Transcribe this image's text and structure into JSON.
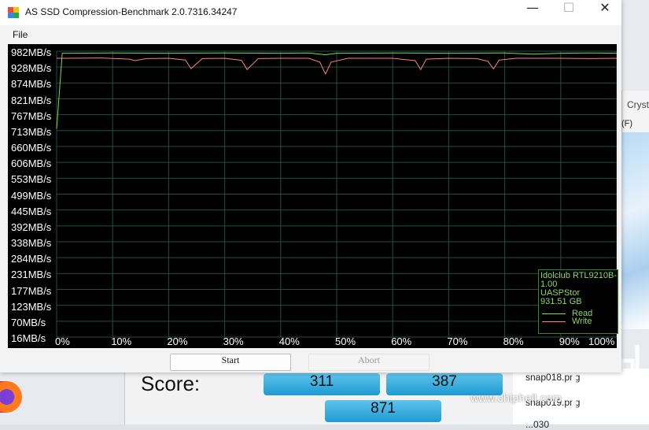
{
  "window": {
    "title": "AS SSD Compression-Benchmark 2.0.7316.34247",
    "minimize_glyph": "—",
    "maximize_glyph": "☐",
    "close_glyph": "✕"
  },
  "menu": {
    "file_label": "File"
  },
  "chart_data": {
    "type": "line",
    "y_tick_labels": [
      "982MB/s",
      "928MB/s",
      "874MB/s",
      "821MB/s",
      "767MB/s",
      "713MB/s",
      "660MB/s",
      "606MB/s",
      "553MB/s",
      "499MB/s",
      "445MB/s",
      "392MB/s",
      "338MB/s",
      "284MB/s",
      "231MB/s",
      "177MB/s",
      "123MB/s",
      "70MB/s",
      "16MB/s"
    ],
    "x_tick_labels": [
      "0%",
      "10%",
      "20%",
      "30%",
      "40%",
      "50%",
      "60%",
      "70%",
      "80%",
      "90%",
      "100%"
    ],
    "ylim": [
      16,
      982
    ],
    "xlim": [
      0,
      100
    ],
    "grid": true,
    "legend_position": "bottom-right",
    "series": [
      {
        "name": "Read",
        "color": "#7ed957",
        "x": [
          0,
          1,
          2,
          10,
          20,
          30,
          40,
          45,
          48,
          50,
          60,
          70,
          80,
          85,
          90,
          95,
          100
        ],
        "y": [
          720,
          975,
          975,
          976,
          975,
          976,
          975,
          976,
          970,
          975,
          976,
          975,
          976,
          972,
          975,
          976,
          975
        ]
      },
      {
        "name": "Write",
        "color": "#ff8080",
        "x": [
          0,
          1,
          2,
          8,
          13,
          14,
          16,
          20,
          23,
          24,
          26,
          30,
          33,
          34,
          36,
          40,
          45,
          47,
          48,
          49,
          52,
          60,
          64,
          65,
          66,
          70,
          75,
          77,
          78,
          79,
          82,
          90,
          95,
          100
        ],
        "y": [
          958,
          958,
          958,
          959,
          955,
          950,
          957,
          958,
          952,
          923,
          957,
          958,
          951,
          920,
          957,
          958,
          958,
          945,
          905,
          945,
          958,
          958,
          950,
          920,
          955,
          958,
          957,
          948,
          922,
          952,
          958,
          958,
          957,
          958
        ]
      }
    ]
  },
  "legend": {
    "device_line1": "Idolclub RTL9210B-",
    "device_line2": "1.00",
    "driver": "UASPStor",
    "capacity": "931.51 GB",
    "read_label": "Read",
    "write_label": "Write"
  },
  "buttons": {
    "start_label": "Start",
    "abort_label": "Abort"
  },
  "background": {
    "score_label": "Score:",
    "score_read": "311",
    "score_write": "387",
    "score_total": "871",
    "file1": "snap018.png",
    "file2": "snap019.png",
    "file3": "...030",
    "crysta_title": "Crysta",
    "crysta_menu": "(F)",
    "watermark": "www.chiphell.com"
  }
}
